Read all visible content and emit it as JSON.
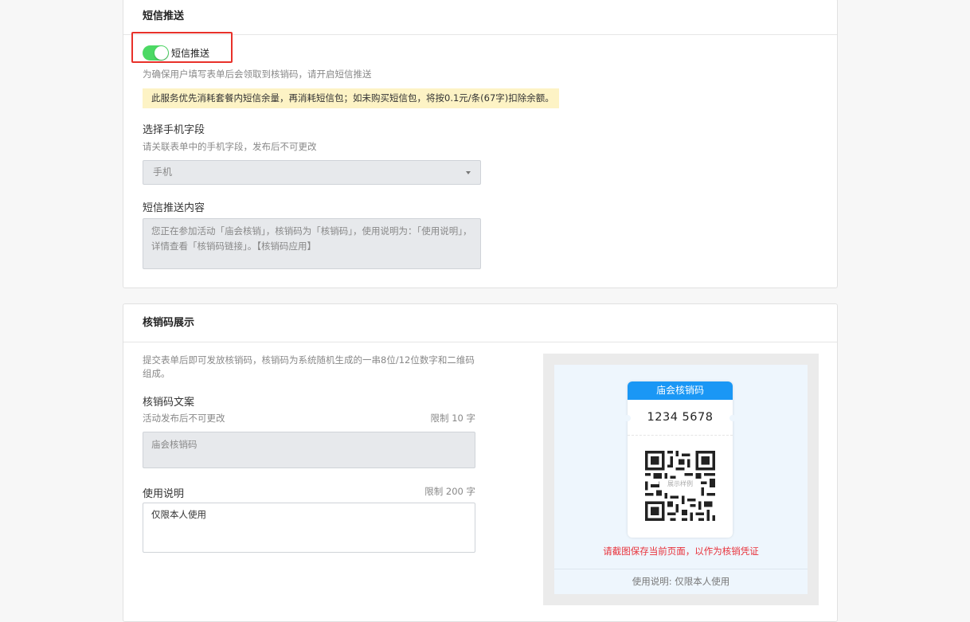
{
  "sms_section": {
    "title": "短信推送",
    "toggle_label": "短信推送",
    "toggle_on": true,
    "toggle_description": "为确保用户填写表单后会领取到核销码，请开启短信推送",
    "notice": "此服务优先消耗套餐内短信余量，再消耗短信包；如未购买短信包，将按0.1元/条(67字)扣除余额。",
    "phone_field": {
      "label": "选择手机字段",
      "hint": "请关联表单中的手机字段，发布后不可更改",
      "value": "手机"
    },
    "content": {
      "label": "短信推送内容",
      "text": "您正在参加活动「庙会核销」，核销码为「核销码」，使用说明为：「使用说明」，详情查看「核销码链接」。【核销码应用】"
    }
  },
  "code_section": {
    "title": "核销码展示",
    "description": "提交表单后即可发放核销码，核销码为系统随机生成的一串8位/12位数字和二维码组成。",
    "copy": {
      "label": "核销码文案",
      "hint": "活动发布后不可更改",
      "limit": "限制 10 字",
      "placeholder": "庙会核销码"
    },
    "instructions": {
      "label": "使用说明",
      "limit": "限制 200 字",
      "value": "仅限本人使用"
    },
    "preview": {
      "ticket_title": "庙会核销码",
      "code": "1234 5678",
      "qr_tag": "展示样例",
      "save_note": "请截图保存当前页面，以作为核销凭证",
      "footer": "使用说明: 仅限本人使用"
    }
  },
  "colors": {
    "toggle_on": "#4cd964",
    "highlight": "#e8312a",
    "notice_bg": "#fdf3c5",
    "ticket_head": "#1a97f5",
    "warning_text": "#e8313a"
  }
}
